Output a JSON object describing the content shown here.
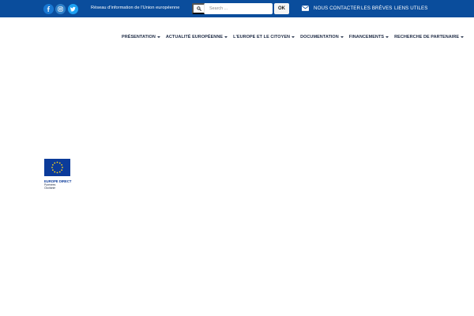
{
  "topbar": {
    "background": "#0a4d9c",
    "social": [
      {
        "icon": "facebook-icon",
        "color": "#1877d2"
      },
      {
        "icon": "instagram-icon",
        "color": "#2f80c8"
      },
      {
        "icon": "twitter-icon",
        "color": "#1da1f2"
      }
    ],
    "tagline": "Réseau d'information de l'Union européenne",
    "search": {
      "icon": "search-icon",
      "placeholder": "Search ...",
      "value": "",
      "ok_label": "OK"
    },
    "links": [
      {
        "icon": "envelope-icon",
        "label": "NOUS CONTACTER"
      },
      {
        "label": "LES BRÈVES"
      },
      {
        "label": "LIENS UTILES"
      }
    ]
  },
  "mainnav": {
    "items": [
      {
        "label": "PRÉSENTATION"
      },
      {
        "label": "ACTUALITÉ EUROPÉENNE"
      },
      {
        "label": "L'EUROPE ET LE CITOYEN"
      },
      {
        "label": "DOCUMENTATION"
      },
      {
        "label": "FINANCEMENTS"
      },
      {
        "label": "RECHERCHE DE PARTENAIRE"
      }
    ]
  },
  "logo": {
    "title": "EUROPE DIRECT",
    "sub_line1": "Pyrénées",
    "sub_line2": "Occitanie",
    "flag_color": "#0b3b9a",
    "star_color": "#ffd617"
  }
}
